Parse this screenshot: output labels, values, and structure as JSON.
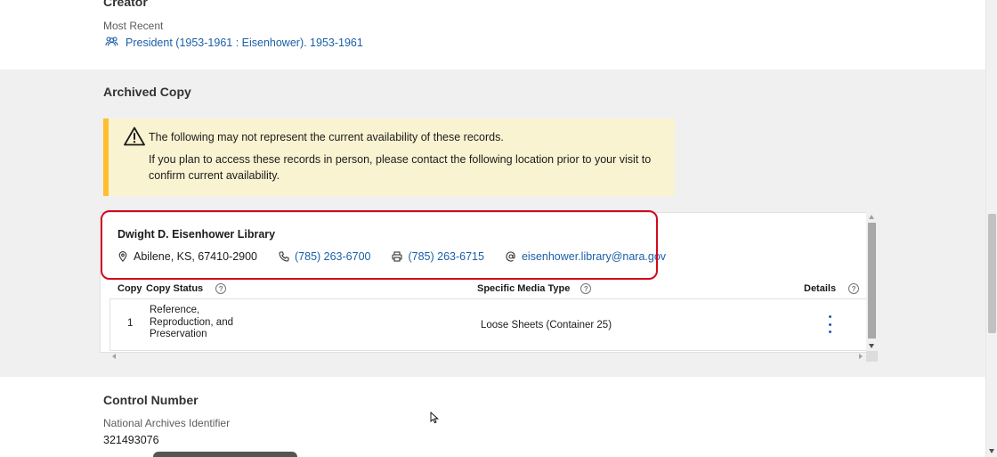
{
  "creator": {
    "title": "Creator",
    "subtitle": "Most Recent",
    "link_text": "President (1953-1961 : Eisenhower). 1953-1961",
    "icon": "group-icon"
  },
  "archived_copy": {
    "title": "Archived Copy",
    "alert": {
      "icon": "warning-icon",
      "line1": "The following may not represent the current availability of these records.",
      "line2": "If you plan to access these records in person, please contact the following location prior to your visit to confirm current availability."
    },
    "location": {
      "name": "Dwight D. Eisenhower Library",
      "address": "Abilene, KS, 67410-2900",
      "phone": "(785) 263-6700",
      "fax": "(785) 263-6715",
      "email": "eisenhower.library@nara.gov"
    },
    "table": {
      "headers": {
        "copy": "Copy",
        "copy_status": "Copy Status",
        "media_type": "Specific Media Type",
        "details": "Details"
      },
      "rows": [
        {
          "copy": "1",
          "status": "Reference, Reproduction, and Preservation",
          "media": "Loose Sheets (Container 25)"
        }
      ]
    }
  },
  "control_number": {
    "title": "Control Number",
    "subtitle": "National Archives Identifier",
    "value": "321493076"
  },
  "colors": {
    "link": "#1a5fa8",
    "alert_bg": "#faf3d1",
    "alert_border": "#ffbe2e",
    "highlight": "#d20a1e"
  }
}
